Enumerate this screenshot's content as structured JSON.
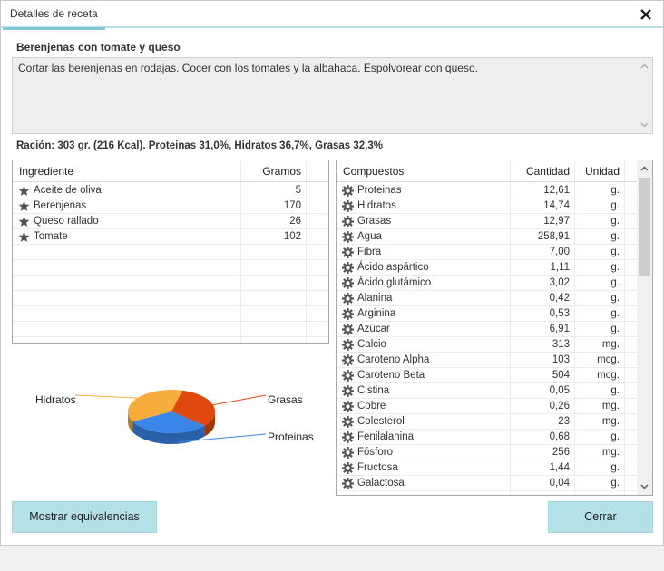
{
  "window": {
    "tab_label": "Detalles de receta",
    "close_label": "✕"
  },
  "recipe": {
    "title": "Berenjenas con tomate y queso",
    "description": "Cortar las berenjenas en rodajas. Cocer con los tomates y la albahaca. Espolvorear con queso.",
    "racion": "Ración: 303 gr. (216 Kcal). Proteinas 31,0%, Hidratos 36,7%, Grasas 32,3%"
  },
  "ingredients": {
    "headers": {
      "name": "Ingrediente",
      "grams": "Gramos"
    },
    "rows": [
      {
        "name": "Aceite de oliva",
        "grams": "5"
      },
      {
        "name": "Berenjenas",
        "grams": "170"
      },
      {
        "name": "Queso rallado",
        "grams": "26"
      },
      {
        "name": "Tomate",
        "grams": "102"
      }
    ],
    "icon": "star-icon"
  },
  "compounds": {
    "headers": {
      "name": "Compuestos",
      "qty": "Cantidad",
      "unit": "Unidad"
    },
    "rows": [
      {
        "name": "Proteinas",
        "qty": "12,61",
        "unit": "g."
      },
      {
        "name": "Hidratos",
        "qty": "14,74",
        "unit": "g."
      },
      {
        "name": "Grasas",
        "qty": "12,97",
        "unit": "g."
      },
      {
        "name": "Agua",
        "qty": "258,91",
        "unit": "g."
      },
      {
        "name": "Fibra",
        "qty": "7,00",
        "unit": "g."
      },
      {
        "name": "Ácido aspártico",
        "qty": "1,11",
        "unit": "g."
      },
      {
        "name": "Ácido glutámico",
        "qty": "3,02",
        "unit": "g."
      },
      {
        "name": "Alanina",
        "qty": "0,42",
        "unit": "g."
      },
      {
        "name": "Arginina",
        "qty": "0,53",
        "unit": "g."
      },
      {
        "name": "Azúcar",
        "qty": "6,91",
        "unit": "g."
      },
      {
        "name": "Calcio",
        "qty": "313",
        "unit": "mg."
      },
      {
        "name": "Caroteno Alpha",
        "qty": "103",
        "unit": "mcg."
      },
      {
        "name": "Caroteno Beta",
        "qty": "504",
        "unit": "mcg."
      },
      {
        "name": "Cistina",
        "qty": "0,05",
        "unit": "g."
      },
      {
        "name": "Cobre",
        "qty": "0,26",
        "unit": "mg."
      },
      {
        "name": "Colesterol",
        "qty": "23",
        "unit": "mg."
      },
      {
        "name": "Fenilalanina",
        "qty": "0,68",
        "unit": "g."
      },
      {
        "name": "Fósforo",
        "qty": "256",
        "unit": "mg."
      },
      {
        "name": "Fructosa",
        "qty": "1,44",
        "unit": "g."
      },
      {
        "name": "Galactosa",
        "qty": "0,04",
        "unit": "g."
      }
    ],
    "icon": "gear-icon"
  },
  "chart_data": {
    "type": "pie",
    "series": [
      {
        "name": "Grasas",
        "value": 32.3,
        "color": "#e0480f"
      },
      {
        "name": "Proteinas",
        "value": 31.0,
        "color": "#3a86e8"
      },
      {
        "name": "Hidratos",
        "value": 36.7,
        "color": "#f7ad3c"
      }
    ],
    "labels": [
      "Hidratos",
      "Grasas",
      "Proteinas"
    ]
  },
  "buttons": {
    "equivalencias": "Mostrar equivalencias",
    "cerrar": "Cerrar"
  },
  "colors": {
    "accent": "#b4e1e7",
    "tab_underline": "#7fc8d4"
  }
}
